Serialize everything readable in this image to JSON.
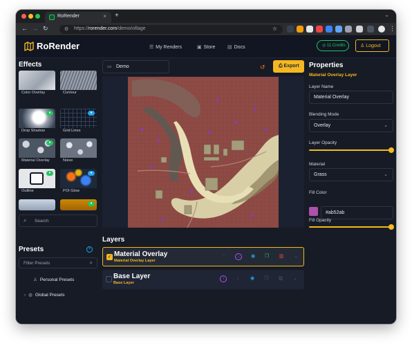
{
  "browser": {
    "tab_title": "RoRender",
    "tab_close": "×",
    "new_tab": "+",
    "url_prefix": "https://",
    "url_host": "rorender.com",
    "url_path": "/demo/village"
  },
  "header": {
    "brand": "RoRender",
    "nav": [
      {
        "label": "My Renders",
        "icon": "list-icon"
      },
      {
        "label": "Store",
        "icon": "store-icon"
      },
      {
        "label": "Docs",
        "icon": "docs-icon"
      }
    ],
    "credits_label": "11 Credits",
    "logout_label": "Logout"
  },
  "effects": {
    "title": "Effects",
    "items": [
      {
        "label": "Color Overlay",
        "active": false
      },
      {
        "label": "Contour",
        "active": false
      },
      {
        "label": "Drop Shadow",
        "active": true
      },
      {
        "label": "Grid Lines",
        "active": true
      },
      {
        "label": "Material Overlay",
        "active": true
      },
      {
        "label": "Noise",
        "active": false
      },
      {
        "label": "Outline",
        "active": true
      },
      {
        "label": "POI Glow",
        "active": true
      }
    ],
    "search_placeholder": "Search"
  },
  "presets": {
    "title": "Presets",
    "filter_placeholder": "Filter Presets",
    "personal_label": "Personal Presets",
    "global_label": "Global Presets"
  },
  "canvas": {
    "preset_name": "Demo",
    "export_label": "Export"
  },
  "layers": {
    "title": "Layers",
    "items": [
      {
        "name": "Material Overlay",
        "subtitle": "Material Overlay Layer",
        "checked": true,
        "selected": true
      },
      {
        "name": "Base Layer",
        "subtitle": "Base Layer",
        "checked": false,
        "selected": false
      }
    ]
  },
  "properties": {
    "title": "Properties",
    "subtitle": "Material Overlay Layer",
    "layer_name_label": "Layer Name",
    "layer_name_value": "Material Overlay",
    "blending_mode_label": "Blending Mode",
    "blending_mode_value": "Overlay",
    "layer_opacity_label": "Layer Opacity",
    "layer_opacity": 1.0,
    "material_label": "Material",
    "material_value": "Grass",
    "fill_color_label": "Fill Color",
    "fill_color_value": "#ab52ab",
    "fill_opacity_label": "Fill Opacity",
    "fill_opacity": 1.0
  },
  "colors": {
    "accent": "#f5b820",
    "bg": "#161b26",
    "credits": "#22c55e",
    "info": "#22a3f0",
    "map_overlay": "#8e4a44"
  }
}
